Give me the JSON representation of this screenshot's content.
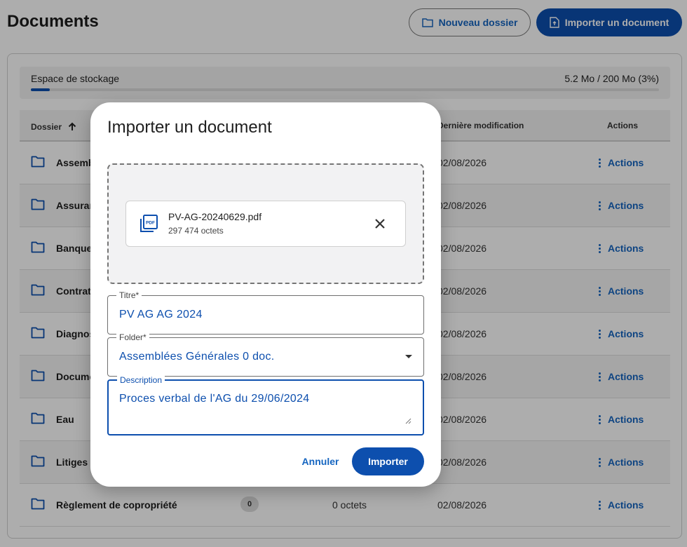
{
  "page": {
    "title": "Documents",
    "new_folder_label": "Nouveau dossier",
    "import_label": "Importer un document"
  },
  "storage": {
    "label": "Espace de stockage",
    "value": "5.2 Mo / 200 Mo (3%)",
    "used_fraction": 0.03
  },
  "table": {
    "headers": {
      "folder": "Dossier",
      "last_modified": "Dernière modification",
      "actions": "Actions"
    },
    "rows": [
      {
        "name": "Assemb",
        "count": "",
        "size": "",
        "date": "02/08/2026",
        "action": "Actions"
      },
      {
        "name": "Assuran",
        "count": "",
        "size": "",
        "date": "02/08/2026",
        "action": "Actions"
      },
      {
        "name": "Banque",
        "count": "",
        "size": "",
        "date": "02/08/2026",
        "action": "Actions"
      },
      {
        "name": "Contrat",
        "count": "",
        "size": "",
        "date": "02/08/2026",
        "action": "Actions"
      },
      {
        "name": "Diagnos",
        "count": "",
        "size": "",
        "date": "02/08/2026",
        "action": "Actions"
      },
      {
        "name": "Docume",
        "count": "",
        "size": "",
        "date": "02/08/2026",
        "action": "Actions"
      },
      {
        "name": "Eau",
        "count": "",
        "size": "",
        "date": "02/08/2026",
        "action": "Actions"
      },
      {
        "name": "Litiges",
        "count": "",
        "size": "",
        "date": "02/08/2026",
        "action": "Actions"
      },
      {
        "name": "Règlement de copropriété",
        "count": "0",
        "size": "0 octets",
        "date": "02/08/2026",
        "action": "Actions"
      }
    ]
  },
  "dialog": {
    "title": "Importer un document",
    "file": {
      "name": "PV-AG-20240629.pdf",
      "size": "297 474 octets"
    },
    "fields": {
      "title": {
        "label": "Titre*",
        "value": "PV AG AG 2024"
      },
      "folder": {
        "label": "Folder*",
        "value": "Assemblées Générales 0 doc."
      },
      "description": {
        "label": "Description",
        "value": "Proces verbal de l'AG du 29/06/2024"
      }
    },
    "cancel_label": "Annuler",
    "submit_label": "Importer"
  },
  "colors": {
    "primary": "#0d4fae",
    "link": "#1565c0"
  }
}
